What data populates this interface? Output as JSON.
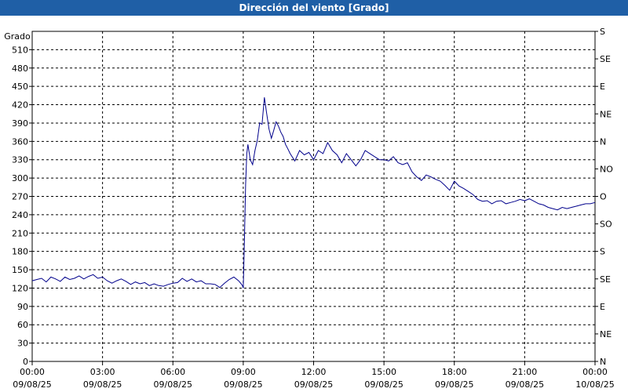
{
  "chart_data": {
    "type": "line",
    "title": "Dirección del viento [Grado]",
    "ylabel": "Grado",
    "ylim": [
      0,
      540
    ],
    "yticks": [
      0,
      30,
      60,
      90,
      120,
      150,
      180,
      210,
      240,
      270,
      300,
      330,
      360,
      390,
      420,
      450,
      480,
      510
    ],
    "right_ticks": [
      "N",
      "NE",
      "E",
      "SE",
      "S",
      "SO",
      "O",
      "NO",
      "N",
      "NE",
      "E",
      "SE",
      "S"
    ],
    "right_tick_values": [
      0,
      45,
      90,
      135,
      180,
      225,
      270,
      315,
      360,
      405,
      450,
      495,
      540
    ],
    "xlim_hours": [
      0,
      24
    ],
    "xticks": [
      {
        "time": "00:00",
        "date": "09/08/25"
      },
      {
        "time": "03:00",
        "date": "09/08/25"
      },
      {
        "time": "06:00",
        "date": "09/08/25"
      },
      {
        "time": "09:00",
        "date": "09/08/25"
      },
      {
        "time": "12:00",
        "date": "09/08/25"
      },
      {
        "time": "15:00",
        "date": "09/08/25"
      },
      {
        "time": "18:00",
        "date": "09/08/25"
      },
      {
        "time": "21:00",
        "date": "09/08/25"
      },
      {
        "time": "00:00",
        "date": "10/08/25"
      }
    ],
    "grid": true,
    "line_color": "#00008b",
    "series": [
      {
        "x": [
          0.0,
          0.2,
          0.4,
          0.6,
          0.8,
          1.0,
          1.2,
          1.4,
          1.6,
          1.8,
          2.0,
          2.2,
          2.4,
          2.6,
          2.8,
          3.0,
          3.2,
          3.4,
          3.6,
          3.8,
          4.0,
          4.2,
          4.4,
          4.6,
          4.8,
          5.0,
          5.2,
          5.4,
          5.6,
          5.8,
          6.0,
          6.2,
          6.4,
          6.6,
          6.8,
          7.0,
          7.2,
          7.4,
          7.6,
          7.8,
          8.0,
          8.2,
          8.4,
          8.6,
          8.8,
          8.95,
          9.0,
          9.05,
          9.1,
          9.15,
          9.2,
          9.3,
          9.4,
          9.5,
          9.6,
          9.7,
          9.8,
          9.9,
          10.0,
          10.1,
          10.2,
          10.3,
          10.4,
          10.5,
          10.6,
          10.7,
          10.8,
          10.9,
          11.0,
          11.2,
          11.4,
          11.6,
          11.8,
          12.0,
          12.2,
          12.4,
          12.6,
          12.8,
          13.0,
          13.2,
          13.4,
          13.6,
          13.8,
          14.0,
          14.2,
          14.4,
          14.6,
          14.8,
          15.0,
          15.2,
          15.4,
          15.6,
          15.8,
          16.0,
          16.2,
          16.4,
          16.6,
          16.8,
          17.0,
          17.2,
          17.4,
          17.6,
          17.8,
          18.0,
          18.2,
          18.4,
          18.6,
          18.8,
          19.0,
          19.2,
          19.4,
          19.6,
          19.8,
          20.0,
          20.2,
          20.4,
          20.6,
          20.8,
          21.0,
          21.2,
          21.4,
          21.6,
          21.8,
          22.0,
          22.2,
          22.4,
          22.6,
          22.8,
          23.0,
          23.2,
          23.4,
          23.6,
          23.8,
          24.0
        ],
        "y": [
          132,
          134,
          136,
          130,
          138,
          135,
          131,
          138,
          134,
          136,
          140,
          135,
          139,
          142,
          136,
          138,
          132,
          128,
          132,
          135,
          131,
          126,
          130,
          127,
          129,
          124,
          127,
          124,
          123,
          126,
          128,
          129,
          136,
          131,
          135,
          130,
          132,
          127,
          127,
          126,
          121,
          128,
          134,
          138,
          132,
          125,
          120,
          200,
          290,
          340,
          355,
          330,
          322,
          345,
          362,
          390,
          388,
          432,
          405,
          380,
          365,
          378,
          392,
          385,
          375,
          368,
          355,
          348,
          340,
          328,
          345,
          338,
          342,
          330,
          345,
          340,
          358,
          345,
          338,
          325,
          340,
          330,
          320,
          330,
          345,
          340,
          335,
          330,
          330,
          328,
          335,
          325,
          322,
          325,
          310,
          302,
          296,
          305,
          302,
          298,
          295,
          288,
          280,
          295,
          287,
          283,
          278,
          273,
          265,
          262,
          263,
          258,
          262,
          263,
          258,
          260,
          262,
          265,
          263,
          266,
          262,
          258,
          256,
          252,
          250,
          248,
          252,
          250,
          252,
          254,
          256,
          258,
          258,
          260
        ]
      }
    ]
  }
}
